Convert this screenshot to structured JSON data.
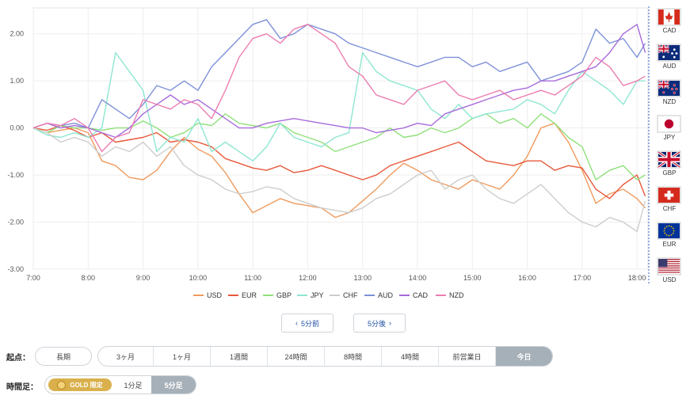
{
  "chart_data": {
    "type": "line",
    "x_ticks": [
      "7:00",
      "8:00",
      "9:00",
      "10:00",
      "11:00",
      "12:00",
      "13:00",
      "14:00",
      "15:00",
      "16:00",
      "17:00",
      "18:00"
    ],
    "y_ticks": [
      "2.00",
      "1.00",
      "0.00",
      "-1.00",
      "-2.00",
      "-3.00"
    ],
    "ylim": [
      -3,
      3
    ],
    "legend_position": "bottom",
    "grid": true,
    "x": [
      7.0,
      7.25,
      7.5,
      7.75,
      8.0,
      8.25,
      8.5,
      8.75,
      9.0,
      9.25,
      9.5,
      9.75,
      10.0,
      10.25,
      10.5,
      10.75,
      11.0,
      11.25,
      11.5,
      11.75,
      12.0,
      12.25,
      12.5,
      12.75,
      13.0,
      13.25,
      13.5,
      13.75,
      14.0,
      14.25,
      14.5,
      14.75,
      15.0,
      15.25,
      15.5,
      15.75,
      16.0,
      16.25,
      16.5,
      16.75,
      17.0,
      17.25,
      17.5,
      17.75,
      18.0,
      18.15
    ],
    "series": [
      {
        "name": "USD",
        "color": "#ef9a5e",
        "values": [
          0.0,
          -0.1,
          -0.05,
          0.0,
          -0.1,
          -0.7,
          -0.8,
          -1.05,
          -1.1,
          -0.9,
          -0.5,
          -0.2,
          -0.45,
          -0.6,
          -0.95,
          -1.4,
          -1.8,
          -1.65,
          -1.5,
          -1.6,
          -1.65,
          -1.7,
          -1.9,
          -1.8,
          -1.55,
          -1.3,
          -1.0,
          -0.75,
          -0.9,
          -1.1,
          -1.2,
          -1.3,
          -1.1,
          -1.2,
          -1.3,
          -1.0,
          -0.6,
          0.0,
          0.1,
          -0.3,
          -0.9,
          -1.6,
          -1.4,
          -1.3,
          -1.5,
          -1.7
        ]
      },
      {
        "name": "EUR",
        "color": "#e8593c",
        "values": [
          0.0,
          -0.05,
          0.05,
          -0.05,
          -0.2,
          -0.1,
          -0.3,
          -0.25,
          -0.2,
          -0.1,
          -0.3,
          -0.25,
          -0.3,
          -0.4,
          -0.65,
          -0.75,
          -0.85,
          -0.9,
          -0.8,
          -0.95,
          -0.9,
          -0.8,
          -0.9,
          -1.0,
          -1.1,
          -1.0,
          -0.8,
          -0.7,
          -0.6,
          -0.5,
          -0.4,
          -0.3,
          -0.5,
          -0.7,
          -0.75,
          -0.8,
          -0.7,
          -0.7,
          -0.9,
          -0.8,
          -0.85,
          -1.3,
          -1.5,
          -1.2,
          -1.0,
          -1.45
        ]
      },
      {
        "name": "GBP",
        "color": "#8fe07a",
        "values": [
          0.0,
          -0.1,
          0.05,
          0.0,
          0.0,
          -0.05,
          0.0,
          0.0,
          0.15,
          0.0,
          -0.2,
          -0.1,
          0.1,
          0.05,
          0.3,
          0.1,
          0.05,
          0.0,
          0.1,
          -0.1,
          -0.2,
          -0.3,
          -0.5,
          -0.4,
          -0.3,
          -0.2,
          0.0,
          -0.2,
          -0.15,
          0.0,
          -0.1,
          0.0,
          0.2,
          0.3,
          0.1,
          0.2,
          0.0,
          0.3,
          0.1,
          -0.2,
          -0.4,
          -1.1,
          -0.9,
          -0.8,
          -1.1,
          -1.0
        ]
      },
      {
        "name": "JPY",
        "color": "#8ee6d2",
        "values": [
          0.0,
          -0.15,
          -0.2,
          -0.1,
          -0.2,
          0.0,
          1.6,
          1.2,
          0.8,
          -0.5,
          -0.2,
          -0.3,
          0.2,
          -0.5,
          -0.3,
          -0.5,
          -0.7,
          -0.4,
          0.1,
          -0.2,
          -0.3,
          -0.4,
          -0.2,
          -0.1,
          1.6,
          1.2,
          1.0,
          0.9,
          0.8,
          0.4,
          0.2,
          0.5,
          0.2,
          0.3,
          0.35,
          0.4,
          0.6,
          0.5,
          0.3,
          0.8,
          1.2,
          1.0,
          0.8,
          0.5,
          1.0,
          1.0
        ]
      },
      {
        "name": "CHF",
        "color": "#cdcdcd",
        "values": [
          0.0,
          -0.1,
          -0.3,
          -0.2,
          -0.3,
          -0.6,
          -0.4,
          -0.5,
          -0.3,
          -0.6,
          -0.4,
          -0.8,
          -1.0,
          -1.1,
          -1.3,
          -1.4,
          -1.35,
          -1.25,
          -1.3,
          -1.5,
          -1.6,
          -1.7,
          -1.75,
          -1.8,
          -1.7,
          -1.5,
          -1.4,
          -1.2,
          -1.0,
          -0.9,
          -1.3,
          -1.1,
          -1.0,
          -1.3,
          -1.5,
          -1.6,
          -1.4,
          -1.2,
          -1.5,
          -1.8,
          -2.0,
          -2.1,
          -1.9,
          -2.0,
          -2.2,
          -1.55
        ]
      },
      {
        "name": "AUD",
        "color": "#7d91d9",
        "values": [
          0.0,
          0.1,
          0.05,
          0.1,
          0.0,
          0.6,
          0.4,
          0.2,
          0.5,
          0.9,
          0.8,
          1.0,
          0.8,
          1.3,
          1.6,
          1.9,
          2.2,
          2.3,
          1.9,
          2.0,
          2.2,
          2.1,
          2.0,
          1.8,
          1.7,
          1.6,
          1.5,
          1.4,
          1.3,
          1.4,
          1.5,
          1.5,
          1.3,
          1.4,
          1.2,
          1.3,
          1.4,
          1.0,
          1.1,
          1.2,
          1.4,
          2.1,
          1.8,
          1.9,
          1.5,
          1.8
        ]
      },
      {
        "name": "CAD",
        "color": "#a86bdc",
        "values": [
          0.0,
          0.1,
          0.0,
          0.05,
          0.0,
          -0.1,
          -0.2,
          0.0,
          0.3,
          0.5,
          0.7,
          0.5,
          0.6,
          0.4,
          0.2,
          0.0,
          0.0,
          0.1,
          0.15,
          0.2,
          0.15,
          0.1,
          0.05,
          0.0,
          0.0,
          -0.1,
          -0.05,
          0.0,
          0.1,
          0.05,
          0.3,
          0.4,
          0.5,
          0.6,
          0.7,
          0.8,
          0.85,
          1.0,
          1.0,
          1.1,
          1.2,
          1.3,
          1.6,
          2.0,
          2.2,
          1.6
        ]
      },
      {
        "name": "NZD",
        "color": "#ec7db0",
        "values": [
          0.0,
          0.1,
          0.05,
          0.2,
          0.0,
          -0.5,
          -0.2,
          -0.1,
          0.6,
          0.5,
          0.4,
          0.6,
          0.5,
          0.2,
          0.8,
          1.5,
          1.9,
          2.0,
          1.8,
          2.1,
          2.2,
          2.0,
          1.8,
          1.3,
          1.1,
          0.7,
          0.6,
          0.5,
          0.8,
          0.9,
          1.0,
          0.7,
          0.6,
          0.7,
          0.8,
          0.6,
          0.7,
          0.8,
          0.7,
          0.9,
          1.1,
          1.5,
          1.3,
          0.9,
          1.0,
          1.1
        ]
      }
    ]
  },
  "flags": [
    {
      "code": "CAD"
    },
    {
      "code": "AUD"
    },
    {
      "code": "NZD"
    },
    {
      "code": "JPY"
    },
    {
      "code": "GBP"
    },
    {
      "code": "CHF"
    },
    {
      "code": "EUR"
    },
    {
      "code": "USD"
    }
  ],
  "nav": {
    "prev_label": "5分前",
    "next_label": "5分後"
  },
  "start": {
    "label": "起点：",
    "long_label": "長期",
    "options": [
      "3ヶ月",
      "1ヶ月",
      "1週間",
      "24時間",
      "8時間",
      "4時間",
      "前営業日",
      "今日"
    ]
  },
  "timeframe": {
    "label": "時間足：",
    "gold_label": "GOLD 限定",
    "options": [
      "1分足",
      "5分足"
    ]
  }
}
